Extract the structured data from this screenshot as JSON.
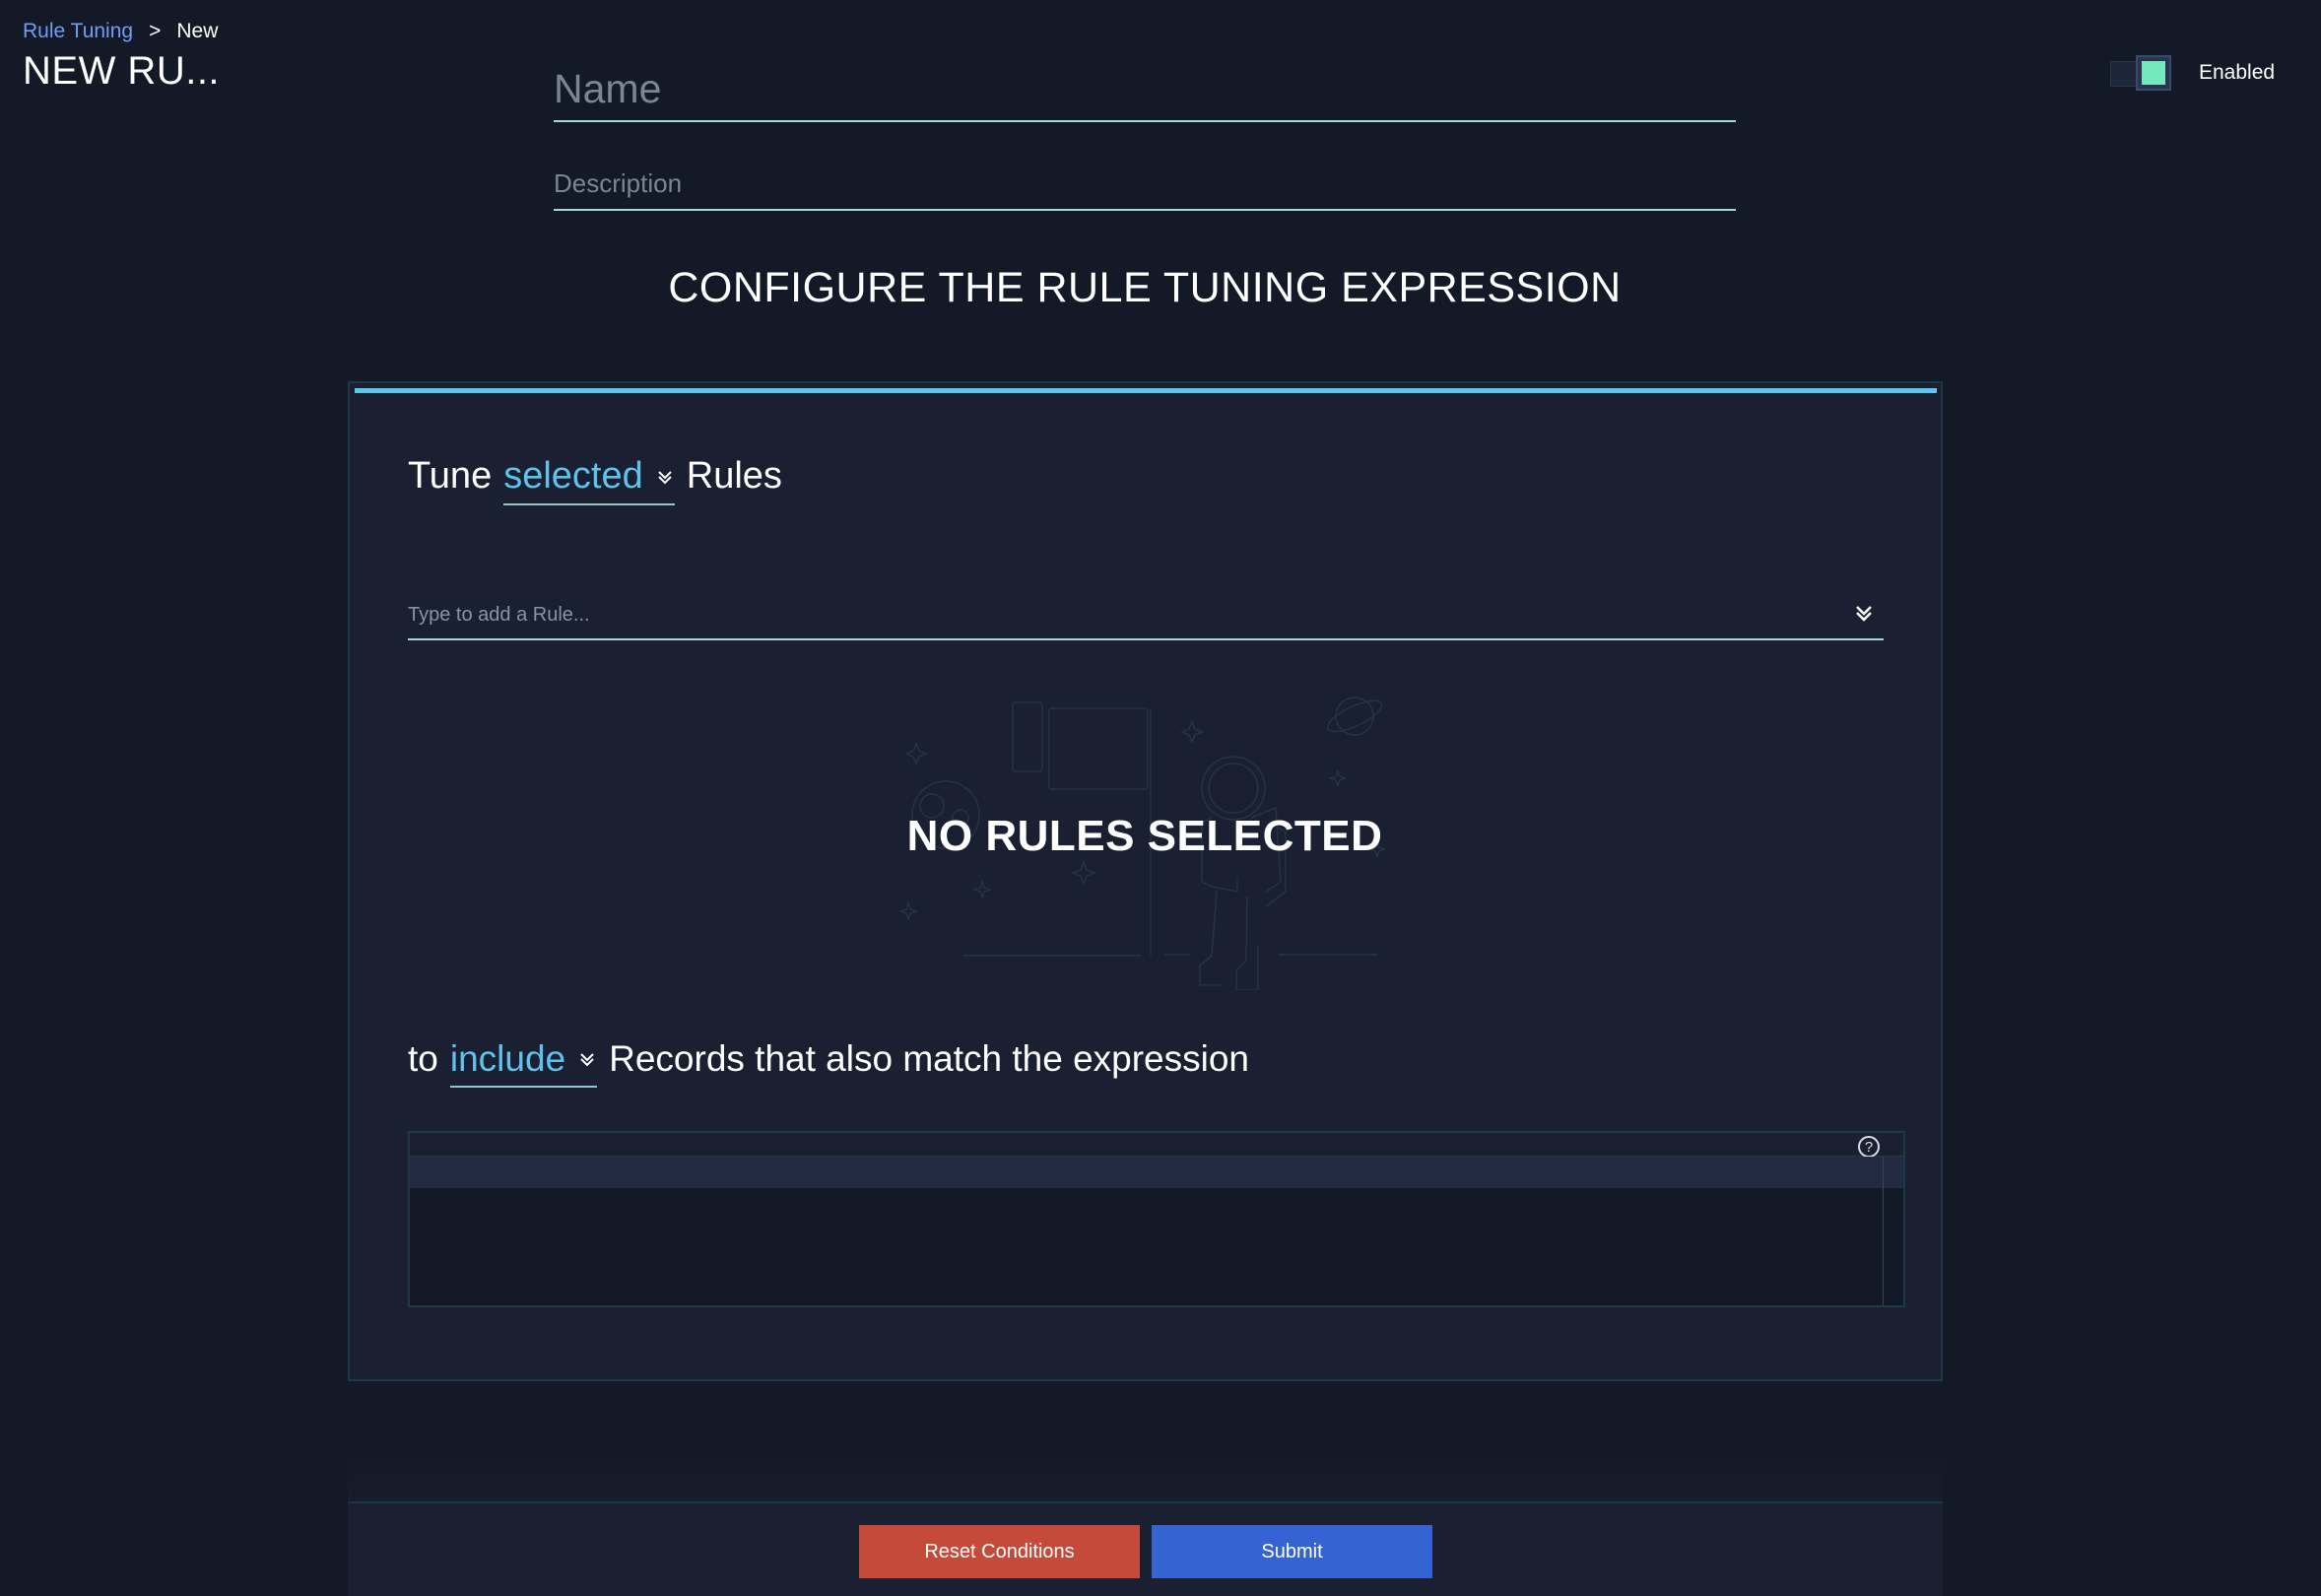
{
  "breadcrumb": {
    "parent": "Rule Tuning",
    "separator": ">",
    "current": "New"
  },
  "page_title": "NEW RU...",
  "form": {
    "name": {
      "value": "",
      "placeholder": "Name"
    },
    "description": {
      "value": "",
      "placeholder": "Description"
    }
  },
  "toggle": {
    "state": "on",
    "label": "Enabled",
    "color": "#74e9bb"
  },
  "section_heading": "CONFIGURE THE RULE TUNING EXPRESSION",
  "tune": {
    "prefix": "Tune",
    "scope_selected": "selected",
    "suffix": "Rules"
  },
  "rule_search": {
    "value": "",
    "placeholder": "Type to add a Rule..."
  },
  "empty_state": {
    "title": "NO RULES SELECTED",
    "illustration": "astronaut-flag-illustration"
  },
  "include": {
    "prefix": "to",
    "mode_selected": "include",
    "suffix": "Records that also match the expression"
  },
  "expression_editor": {
    "value": "",
    "help_icon": "?"
  },
  "footer": {
    "reset_label": "Reset Conditions",
    "submit_label": "Submit"
  },
  "colors": {
    "accent": "#5bc8ef",
    "link": "#6f9ff2",
    "reset": "#c54a3a",
    "submit": "#3563d3",
    "toggle_on": "#74e9bb"
  }
}
